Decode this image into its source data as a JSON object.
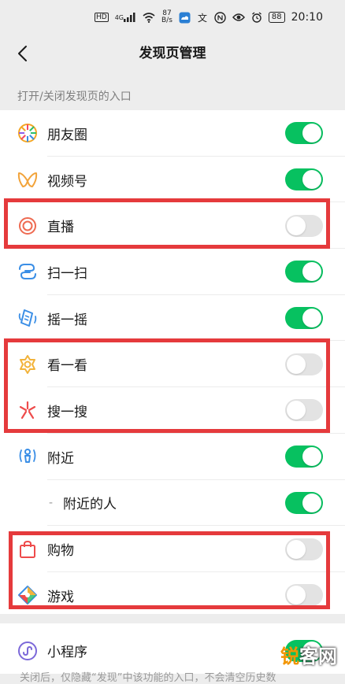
{
  "status_bar": {
    "hd_badge": "HD",
    "network": "4G",
    "speed_value": "87",
    "speed_unit": "B/s",
    "battery": "88",
    "time": "20:10"
  },
  "nav": {
    "title": "发现页管理"
  },
  "section_label": "打开/关闭发现页的入口",
  "items": [
    {
      "label": "朋友圈",
      "icon": "moments-icon",
      "on": true
    },
    {
      "label": "视频号",
      "icon": "channels-icon",
      "on": true
    },
    {
      "label": "直播",
      "icon": "live-icon",
      "on": false
    },
    {
      "label": "扫一扫",
      "icon": "scan-icon",
      "on": true
    },
    {
      "label": "摇一摇",
      "icon": "shake-icon",
      "on": true
    },
    {
      "label": "看一看",
      "icon": "top-stories-icon",
      "on": false
    },
    {
      "label": "搜一搜",
      "icon": "search-icon",
      "on": false
    },
    {
      "label": "附近",
      "icon": "nearby-icon",
      "on": true
    },
    {
      "label": "附近的人",
      "icon": "dash",
      "on": true
    },
    {
      "label": "购物",
      "icon": "shopping-bag-icon",
      "on": false
    },
    {
      "label": "游戏",
      "icon": "games-icon",
      "on": false
    },
    {
      "label": "小程序",
      "icon": "mini-programs-icon",
      "on": true
    }
  ],
  "sub_dash": "-",
  "footer_note": "关闭后，仅隐藏“发现”中该功能的入口，不会清空历史数",
  "watermark": {
    "part1": "锐",
    "part2": "客网"
  },
  "colors": {
    "toggle_on": "#07c160",
    "toggle_off": "#e3e3e3",
    "highlight": "#e53a3c",
    "background": "#ededed"
  }
}
